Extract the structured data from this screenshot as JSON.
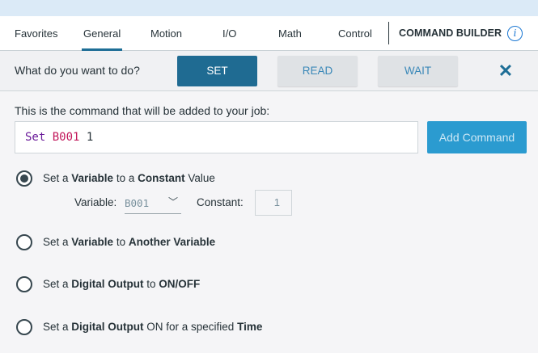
{
  "tabs": [
    {
      "label": "Favorites",
      "active": false
    },
    {
      "label": "General",
      "active": true
    },
    {
      "label": "Motion",
      "active": false
    },
    {
      "label": "I/O",
      "active": false
    },
    {
      "label": "Math",
      "active": false
    },
    {
      "label": "Control",
      "active": false
    }
  ],
  "header": {
    "title": "COMMAND BUILDER",
    "info_icon": "info-icon",
    "info_glyph": "i"
  },
  "prompt": {
    "label": "What do you want to do?",
    "modes": [
      {
        "label": "SET",
        "selected": true
      },
      {
        "label": "READ",
        "selected": false
      },
      {
        "label": "WAIT",
        "selected": false
      }
    ],
    "close_glyph": "✕"
  },
  "command": {
    "caption": "This is the command that will be added to your job:",
    "keyword": "Set",
    "variable": "B001",
    "value": "1",
    "add_label": "Add Command"
  },
  "options": [
    {
      "parts": [
        "Set a ",
        "Variable",
        " to a ",
        "Constant",
        " Value"
      ],
      "checked": true
    },
    {
      "parts": [
        "Set a ",
        "Variable",
        " to ",
        "Another Variable",
        ""
      ],
      "checked": false
    },
    {
      "parts": [
        "Set a ",
        "Digital Output",
        " to ",
        "ON/OFF",
        ""
      ],
      "checked": false
    },
    {
      "parts": [
        "Set a ",
        "Digital Output",
        " ON for a specified ",
        "Time",
        ""
      ],
      "checked": false
    }
  ],
  "sub": {
    "variable_label": "Variable:",
    "variable_value": "B001",
    "chevron_glyph": "﹀",
    "constant_label": "Constant:",
    "constant_value": "1"
  },
  "colors": {
    "accent": "#1f6b92",
    "add_button": "#2b9bd0",
    "link": "#3a88b8"
  }
}
